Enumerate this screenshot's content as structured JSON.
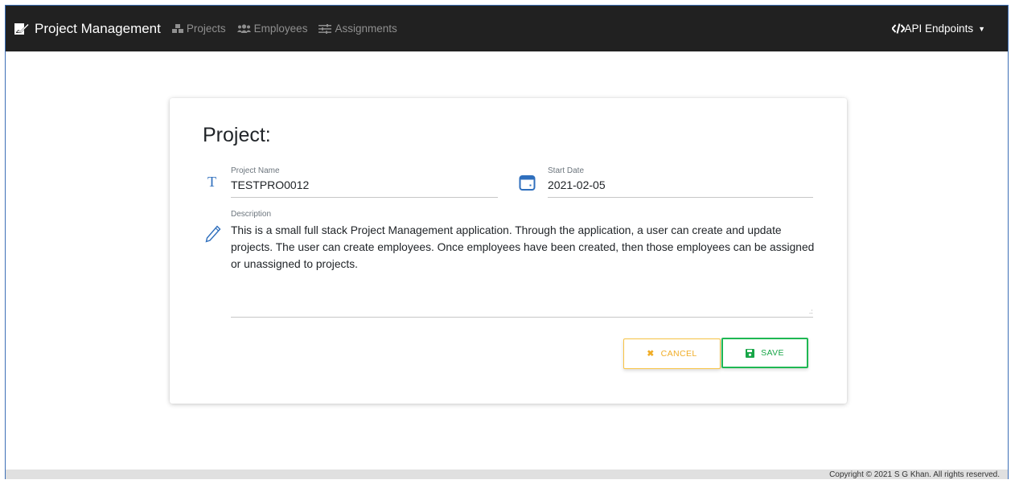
{
  "navbar": {
    "brand": "Project Management",
    "links": [
      {
        "label": "Projects",
        "icon": "cubes-icon"
      },
      {
        "label": "Employees",
        "icon": "users-icon"
      },
      {
        "label": "Assignments",
        "icon": "sliders-icon"
      }
    ],
    "api": "API Endpoints",
    "api_icon": "code-icon"
  },
  "form": {
    "title": "Project:",
    "project_name": {
      "label": "Project Name",
      "value": "TESTPRO0012",
      "icon": "text-icon"
    },
    "start_date": {
      "label": "Start Date",
      "value": "2021-02-05",
      "icon": "calendar-icon"
    },
    "description": {
      "label": "Description",
      "value": "This is a small full stack Project Management application. Through the application, a user can create and update projects.  The user can create employees.  Once employees have been created, then those employees can be assigned or unassigned to projects.",
      "icon": "pencil-icon"
    },
    "cancel_label": "CANCEL",
    "save_label": "SAVE"
  },
  "footer": {
    "text": "Copyright © 2021 S G Khan. All rights reserved."
  },
  "colors": {
    "navbar": "#212121",
    "cancel": "#f0ad27",
    "save": "#18a648",
    "icon_blue": "#2f6fbd"
  }
}
